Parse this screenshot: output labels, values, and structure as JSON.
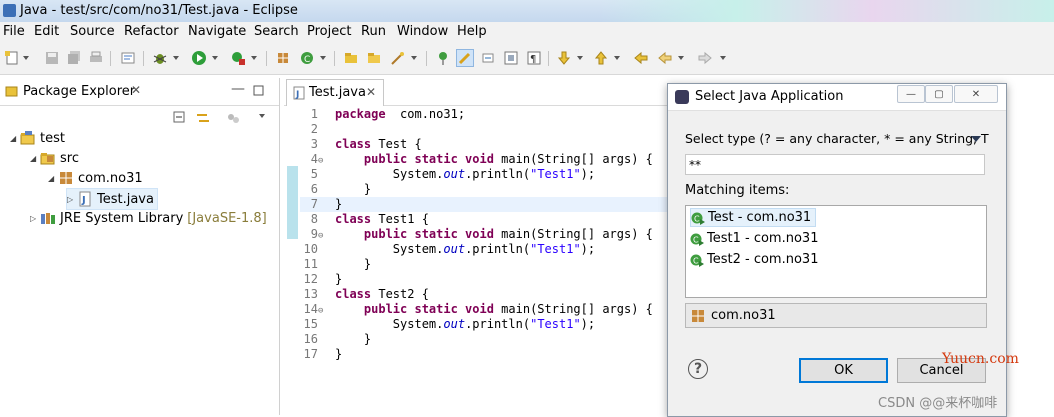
{
  "window": {
    "title": "Java - test/src/com/no31/Test.java - Eclipse"
  },
  "menu": [
    "File",
    "Edit",
    "Source",
    "Refactor",
    "Navigate",
    "Search",
    "Project",
    "Run",
    "Window",
    "Help"
  ],
  "package_explorer": {
    "tab_label": "Package Explorer",
    "tree": [
      {
        "label": "test",
        "extra": ""
      },
      {
        "label": "src",
        "extra": ""
      },
      {
        "label": "com.no31",
        "extra": ""
      },
      {
        "label": "Test.java",
        "extra": ""
      },
      {
        "label": "JRE System Library",
        "extra": "[JavaSE-1.8]"
      }
    ]
  },
  "editor": {
    "tab_label": "Test.java",
    "lines": [
      {
        "n": "1",
        "fold": "",
        "code": [
          [
            "kw",
            "package"
          ],
          [
            "",
            "  com.no31;"
          ]
        ]
      },
      {
        "n": "2",
        "fold": "",
        "code": []
      },
      {
        "n": "3",
        "fold": "",
        "code": [
          [
            "kw",
            "class"
          ],
          [
            "",
            " Test {"
          ]
        ]
      },
      {
        "n": "4",
        "fold": "⊖",
        "code": [
          [
            "",
            "    "
          ],
          [
            "kw",
            "public static void"
          ],
          [
            "",
            " main(String[] args) {"
          ]
        ]
      },
      {
        "n": "5",
        "fold": "",
        "code": [
          [
            "",
            "        System."
          ],
          [
            "fld",
            "out"
          ],
          [
            "",
            ".println("
          ],
          [
            "str",
            "\"Test1\""
          ],
          [
            "",
            ");"
          ]
        ]
      },
      {
        "n": "6",
        "fold": "",
        "code": [
          [
            "",
            "    }"
          ]
        ]
      },
      {
        "n": "7",
        "fold": "",
        "code": [
          [
            "",
            "}"
          ]
        ]
      },
      {
        "n": "8",
        "fold": "",
        "code": [
          [
            "kw",
            "class"
          ],
          [
            "",
            " Test1 {"
          ]
        ]
      },
      {
        "n": "9",
        "fold": "⊖",
        "code": [
          [
            "",
            "    "
          ],
          [
            "kw",
            "public static void"
          ],
          [
            "",
            " main(String[] args) {"
          ]
        ]
      },
      {
        "n": "10",
        "fold": "",
        "code": [
          [
            "",
            "        System."
          ],
          [
            "fld",
            "out"
          ],
          [
            "",
            ".println("
          ],
          [
            "str",
            "\"Test1\""
          ],
          [
            "",
            ");"
          ]
        ]
      },
      {
        "n": "11",
        "fold": "",
        "code": [
          [
            "",
            "    }"
          ]
        ]
      },
      {
        "n": "12",
        "fold": "",
        "code": [
          [
            "",
            "}"
          ]
        ]
      },
      {
        "n": "13",
        "fold": "",
        "code": [
          [
            "kw",
            "class"
          ],
          [
            "",
            " Test2 {"
          ]
        ]
      },
      {
        "n": "14",
        "fold": "⊖",
        "code": [
          [
            "",
            "    "
          ],
          [
            "kw",
            "public static void"
          ],
          [
            "",
            " main(String[] args) {"
          ]
        ]
      },
      {
        "n": "15",
        "fold": "",
        "code": [
          [
            "",
            "        System."
          ],
          [
            "fld",
            "out"
          ],
          [
            "",
            ".println("
          ],
          [
            "str",
            "\"Test1\""
          ],
          [
            "",
            ");"
          ]
        ]
      },
      {
        "n": "16",
        "fold": "",
        "code": [
          [
            "",
            "    }"
          ]
        ]
      },
      {
        "n": "17",
        "fold": "",
        "code": [
          [
            "",
            "}"
          ]
        ]
      }
    ]
  },
  "dialog": {
    "title": "Select Java Application",
    "select_type_label": "Select type (? = any character, * = any String, T",
    "filter_value": "**",
    "matching_label": "Matching items:",
    "items": [
      "Test - com.no31",
      "Test1 - com.no31",
      "Test2 - com.no31"
    ],
    "package": "com.no31",
    "ok_label": "OK",
    "cancel_label": "Cancel",
    "help_symbol": "?"
  },
  "watermarks": {
    "site": "Yuucn.com",
    "csdn": "CSDN @@来杯咖啡"
  },
  "colors": {
    "keyword": "#7f0055",
    "string": "#2a00ff",
    "field": "#0000c0",
    "selection": "#e5f1fb"
  }
}
